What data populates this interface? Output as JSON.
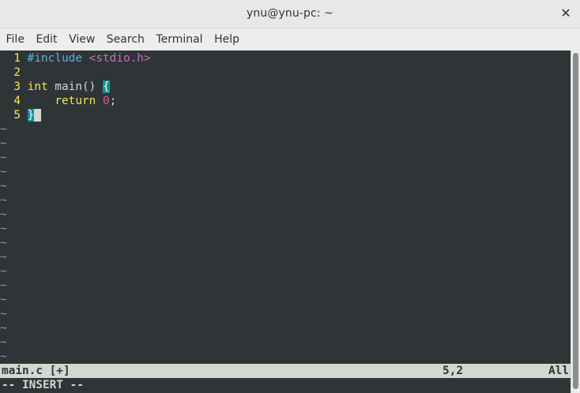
{
  "window": {
    "title": "ynu@ynu-pc: ~",
    "close_glyph": "✕"
  },
  "menu": [
    "File",
    "Edit",
    "View",
    "Search",
    "Terminal",
    "Help"
  ],
  "editor": {
    "lines": [
      {
        "num": "1",
        "segments": [
          {
            "text": "#include",
            "cls": "pre"
          },
          {
            "text": " "
          },
          {
            "text": "<stdio.h>",
            "cls": "str"
          }
        ]
      },
      {
        "num": "2",
        "segments": []
      },
      {
        "num": "3",
        "segments": [
          {
            "text": "int",
            "cls": "kw"
          },
          {
            "text": " main() "
          },
          {
            "text": "{",
            "cls": "brace-hl"
          }
        ]
      },
      {
        "num": "4",
        "segments": [
          {
            "text": "    "
          },
          {
            "text": "return",
            "cls": "kw"
          },
          {
            "text": " "
          },
          {
            "text": "0",
            "cls": "num"
          },
          {
            "text": ";"
          }
        ]
      },
      {
        "num": "5",
        "segments": [
          {
            "text": "}",
            "cls": "brace-hl"
          },
          {
            "text": " ",
            "cls": "cursor"
          }
        ]
      }
    ],
    "tilde": "~",
    "tilde_count": 17
  },
  "status": {
    "filename": "main.c [+]",
    "position": "5,2",
    "percent": "All"
  },
  "mode": "-- INSERT --",
  "colors": {
    "terminal_bg": "#2f3437",
    "line_number": "#fce94f",
    "tilde": "#729fcf",
    "preprocessor": "#5fb0e0",
    "string": "#c46fb8",
    "keyword": "#f2e35a",
    "number": "#d05ca0",
    "brace_highlight": "#06989a"
  }
}
